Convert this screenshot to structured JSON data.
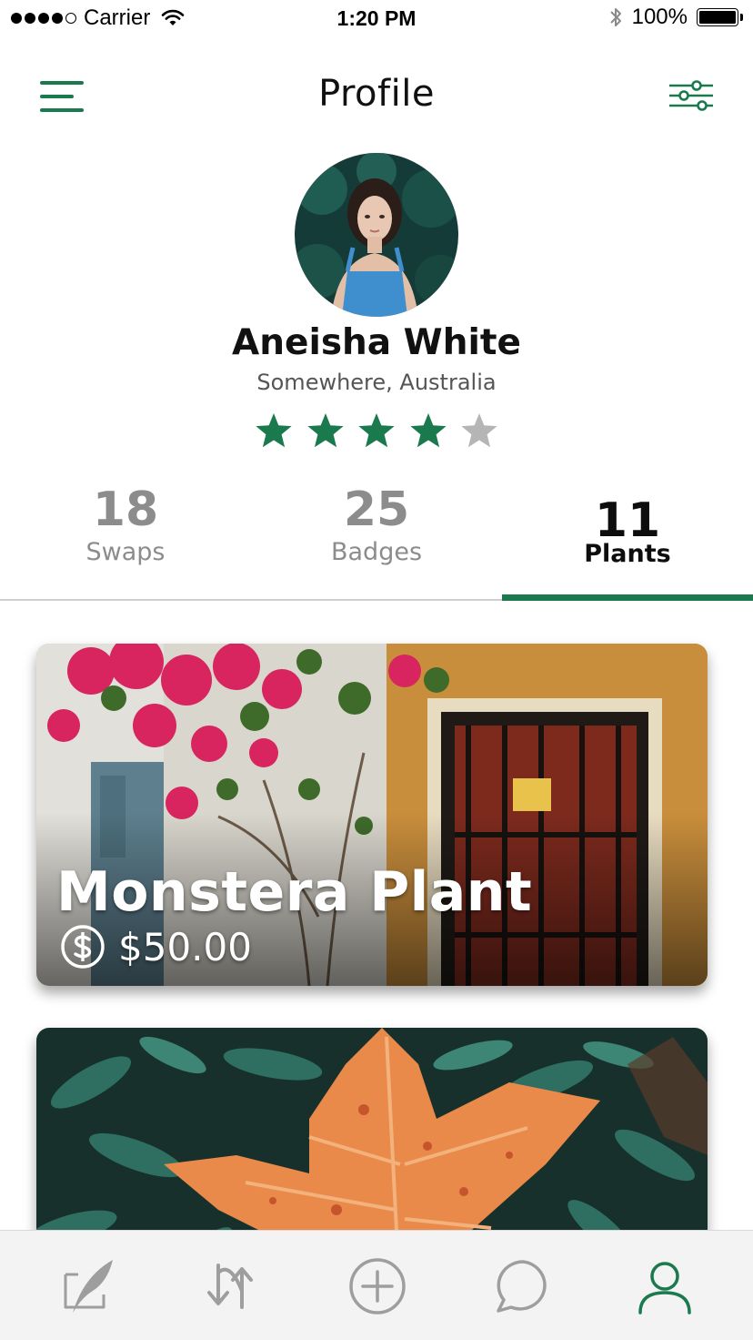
{
  "status_bar": {
    "carrier": "Carrier",
    "time": "1:20 PM",
    "battery": "100%"
  },
  "header": {
    "title": "Profile",
    "left_icon": "hamburger-menu-icon",
    "right_icon": "filter-sliders-icon"
  },
  "profile": {
    "name": "Aneisha White",
    "location": "Somewhere, Australia",
    "rating": 4,
    "rating_max": 5
  },
  "stats": [
    {
      "value": "18",
      "label": "Swaps",
      "active": false
    },
    {
      "value": "25",
      "label": "Badges",
      "active": false
    },
    {
      "value": "11",
      "label": "Plants",
      "active": true
    }
  ],
  "plants": [
    {
      "title": "Monstera Plant",
      "price": "$50.00",
      "price_icon": "dollar-circle-icon"
    },
    {
      "title": "",
      "price": ""
    }
  ],
  "tabbar": {
    "items": [
      {
        "icon": "feather-post-icon",
        "active": false
      },
      {
        "icon": "swap-arrows-icon",
        "active": false
      },
      {
        "icon": "add-circle-icon",
        "active": false
      },
      {
        "icon": "chat-bubble-icon",
        "active": false
      },
      {
        "icon": "user-profile-icon",
        "active": true
      }
    ]
  },
  "colors": {
    "accent": "#1a7a4d",
    "star_inactive": "#b5b5b5",
    "tab_inactive": "#9e9e9e"
  }
}
